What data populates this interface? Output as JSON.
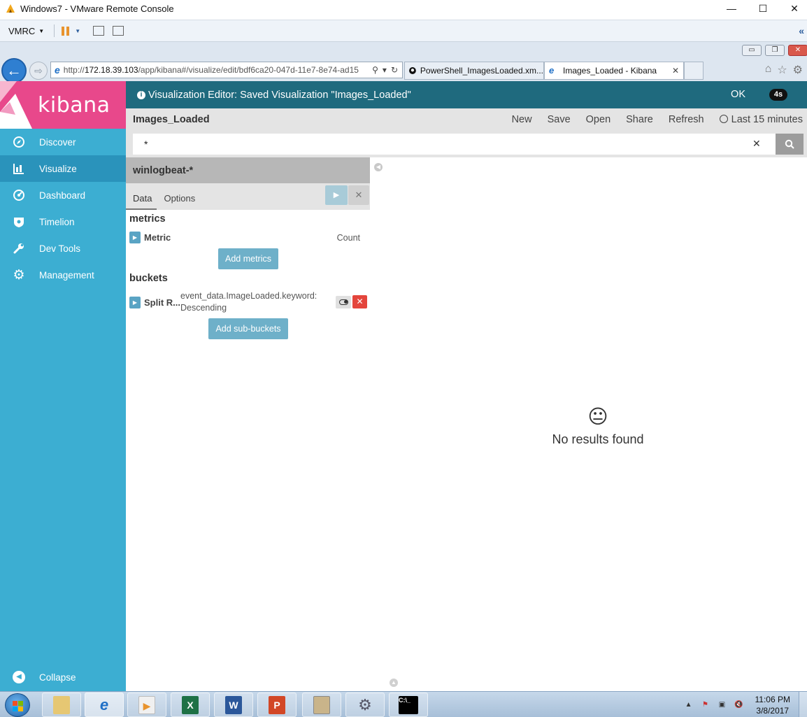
{
  "window": {
    "title": "Windows7 - VMware Remote Console"
  },
  "vmrc_toolbar": {
    "menu_label": "VMRC"
  },
  "browser": {
    "url_host": "172.18.39.103",
    "url_prefix": "http://",
    "url_path": "/app/kibana#/visualize/edit/bdf6ca20-047d-11e7-8e74-ad15",
    "tabs": [
      {
        "title": "PowerShell_ImagesLoaded.xm...",
        "active": false
      },
      {
        "title": "Images_Loaded - Kibana",
        "active": true
      }
    ]
  },
  "kibana": {
    "logo_text": "kibana",
    "nav": [
      {
        "label": "Discover",
        "icon": "compass-icon",
        "active": false
      },
      {
        "label": "Visualize",
        "icon": "bar-chart-icon",
        "active": true
      },
      {
        "label": "Dashboard",
        "icon": "dashboard-gauge-icon",
        "active": false
      },
      {
        "label": "Timelion",
        "icon": "timelion-shield-icon",
        "active": false
      },
      {
        "label": "Dev Tools",
        "icon": "wrench-icon",
        "active": false
      },
      {
        "label": "Management",
        "icon": "gear-icon",
        "active": false
      }
    ],
    "collapse_label": "Collapse",
    "editor_bar": {
      "message": "Visualization Editor: Saved Visualization \"Images_Loaded\"",
      "ok_label": "OK",
      "timer_label": "4s"
    },
    "top_menu": {
      "title": "Images_Loaded",
      "items": [
        "New",
        "Save",
        "Open",
        "Share",
        "Refresh"
      ],
      "time_range": "Last 15 minutes"
    },
    "query": {
      "value": "*"
    },
    "panel": {
      "index_pattern": "winlogbeat-*",
      "tabs": [
        "Data",
        "Options"
      ],
      "metrics_title": "metrics",
      "metric_name": "Metric",
      "metric_value": "Count",
      "add_metrics_label": "Add metrics",
      "buckets_title": "buckets",
      "bucket_name": "Split R...",
      "bucket_field": "event_data.ImageLoaded.keyword:",
      "bucket_order": "Descending",
      "add_sub_buckets_label": "Add sub-buckets"
    },
    "no_results": "No results found"
  },
  "taskbar": {
    "time": "11:06 PM",
    "date": "3/8/2017"
  }
}
